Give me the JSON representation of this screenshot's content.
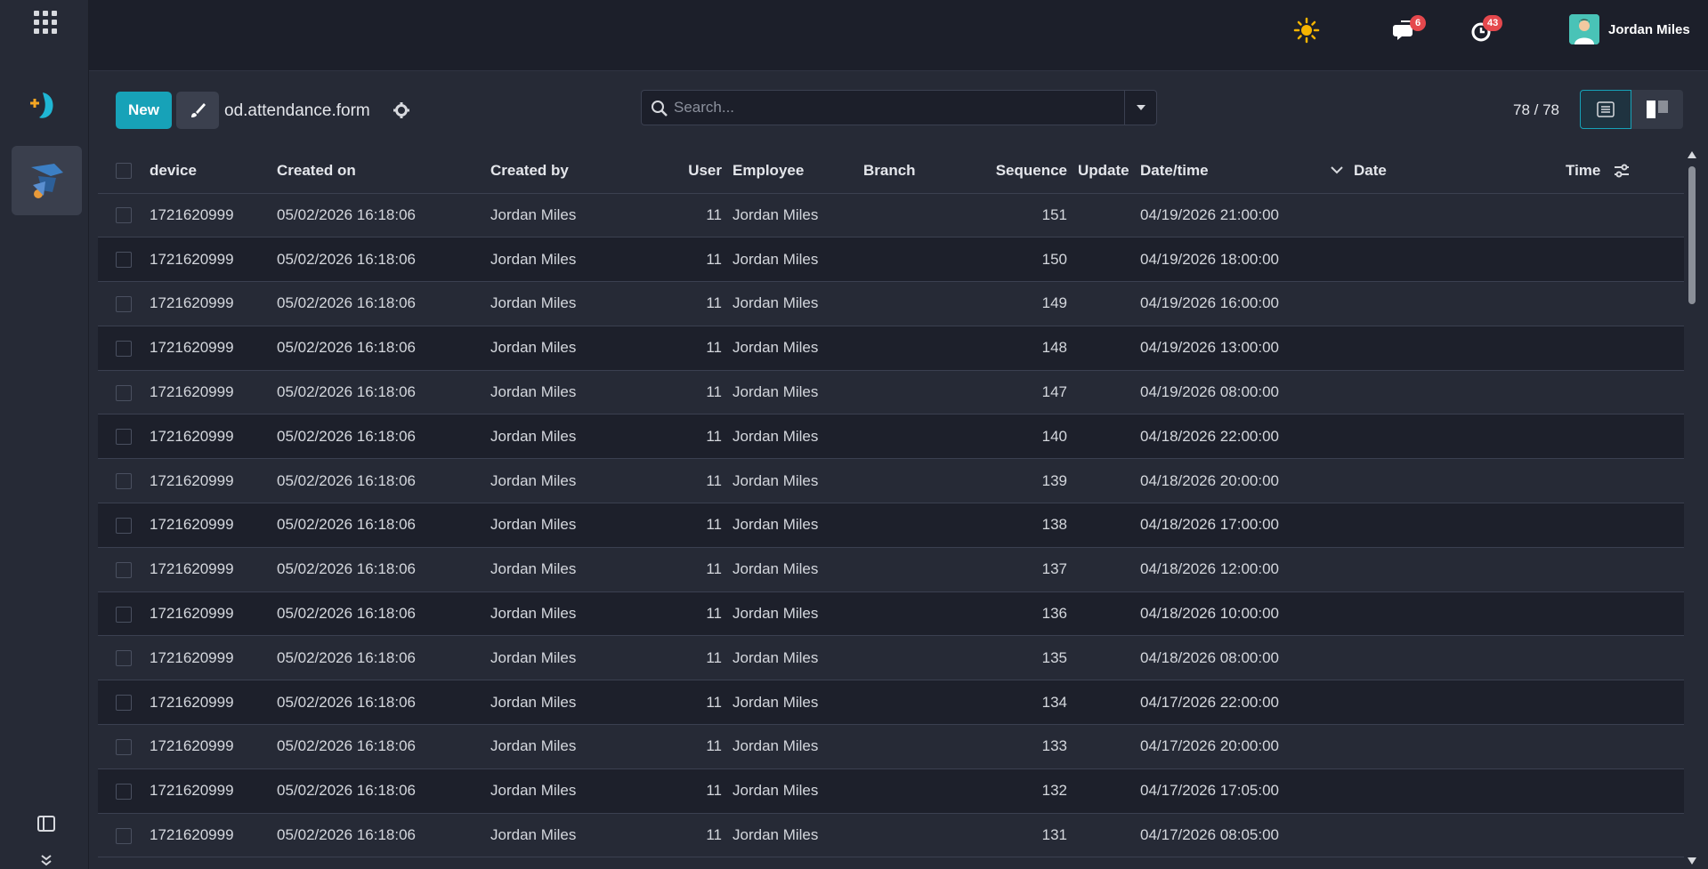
{
  "topbar": {
    "user_name": "Jordan Miles",
    "messages_count": "6",
    "activities_count": "43"
  },
  "control": {
    "new_label": "New",
    "model_name": "od.attendance.form",
    "search_placeholder": "Search...",
    "pager": "78 / 78"
  },
  "table": {
    "headers": {
      "device": "device",
      "created_on": "Created on",
      "created_by": "Created by",
      "user": "User",
      "employee": "Employee",
      "branch": "Branch",
      "sequence": "Sequence",
      "update": "Update",
      "datetime": "Date/time",
      "date": "Date",
      "time": "Time"
    },
    "rows": [
      {
        "device": "1721620999",
        "created_on": "05/02/2026 16:18:06",
        "created_by": "Jordan Miles",
        "user": "11",
        "employee": "Jordan Miles",
        "branch": "",
        "sequence": "151",
        "update": "",
        "datetime": "04/19/2026 21:00:00",
        "date": "",
        "time": ""
      },
      {
        "device": "1721620999",
        "created_on": "05/02/2026 16:18:06",
        "created_by": "Jordan Miles",
        "user": "11",
        "employee": "Jordan Miles",
        "branch": "",
        "sequence": "150",
        "update": "",
        "datetime": "04/19/2026 18:00:00",
        "date": "",
        "time": ""
      },
      {
        "device": "1721620999",
        "created_on": "05/02/2026 16:18:06",
        "created_by": "Jordan Miles",
        "user": "11",
        "employee": "Jordan Miles",
        "branch": "",
        "sequence": "149",
        "update": "",
        "datetime": "04/19/2026 16:00:00",
        "date": "",
        "time": ""
      },
      {
        "device": "1721620999",
        "created_on": "05/02/2026 16:18:06",
        "created_by": "Jordan Miles",
        "user": "11",
        "employee": "Jordan Miles",
        "branch": "",
        "sequence": "148",
        "update": "",
        "datetime": "04/19/2026 13:00:00",
        "date": "",
        "time": ""
      },
      {
        "device": "1721620999",
        "created_on": "05/02/2026 16:18:06",
        "created_by": "Jordan Miles",
        "user": "11",
        "employee": "Jordan Miles",
        "branch": "",
        "sequence": "147",
        "update": "",
        "datetime": "04/19/2026 08:00:00",
        "date": "",
        "time": ""
      },
      {
        "device": "1721620999",
        "created_on": "05/02/2026 16:18:06",
        "created_by": "Jordan Miles",
        "user": "11",
        "employee": "Jordan Miles",
        "branch": "",
        "sequence": "140",
        "update": "",
        "datetime": "04/18/2026 22:00:00",
        "date": "",
        "time": ""
      },
      {
        "device": "1721620999",
        "created_on": "05/02/2026 16:18:06",
        "created_by": "Jordan Miles",
        "user": "11",
        "employee": "Jordan Miles",
        "branch": "",
        "sequence": "139",
        "update": "",
        "datetime": "04/18/2026 20:00:00",
        "date": "",
        "time": ""
      },
      {
        "device": "1721620999",
        "created_on": "05/02/2026 16:18:06",
        "created_by": "Jordan Miles",
        "user": "11",
        "employee": "Jordan Miles",
        "branch": "",
        "sequence": "138",
        "update": "",
        "datetime": "04/18/2026 17:00:00",
        "date": "",
        "time": ""
      },
      {
        "device": "1721620999",
        "created_on": "05/02/2026 16:18:06",
        "created_by": "Jordan Miles",
        "user": "11",
        "employee": "Jordan Miles",
        "branch": "",
        "sequence": "137",
        "update": "",
        "datetime": "04/18/2026 12:00:00",
        "date": "",
        "time": ""
      },
      {
        "device": "1721620999",
        "created_on": "05/02/2026 16:18:06",
        "created_by": "Jordan Miles",
        "user": "11",
        "employee": "Jordan Miles",
        "branch": "",
        "sequence": "136",
        "update": "",
        "datetime": "04/18/2026 10:00:00",
        "date": "",
        "time": ""
      },
      {
        "device": "1721620999",
        "created_on": "05/02/2026 16:18:06",
        "created_by": "Jordan Miles",
        "user": "11",
        "employee": "Jordan Miles",
        "branch": "",
        "sequence": "135",
        "update": "",
        "datetime": "04/18/2026 08:00:00",
        "date": "",
        "time": ""
      },
      {
        "device": "1721620999",
        "created_on": "05/02/2026 16:18:06",
        "created_by": "Jordan Miles",
        "user": "11",
        "employee": "Jordan Miles",
        "branch": "",
        "sequence": "134",
        "update": "",
        "datetime": "04/17/2026 22:00:00",
        "date": "",
        "time": ""
      },
      {
        "device": "1721620999",
        "created_on": "05/02/2026 16:18:06",
        "created_by": "Jordan Miles",
        "user": "11",
        "employee": "Jordan Miles",
        "branch": "",
        "sequence": "133",
        "update": "",
        "datetime": "04/17/2026 20:00:00",
        "date": "",
        "time": ""
      },
      {
        "device": "1721620999",
        "created_on": "05/02/2026 16:18:06",
        "created_by": "Jordan Miles",
        "user": "11",
        "employee": "Jordan Miles",
        "branch": "",
        "sequence": "132",
        "update": "",
        "datetime": "04/17/2026 17:05:00",
        "date": "",
        "time": ""
      },
      {
        "device": "1721620999",
        "created_on": "05/02/2026 16:18:06",
        "created_by": "Jordan Miles",
        "user": "11",
        "employee": "Jordan Miles",
        "branch": "",
        "sequence": "131",
        "update": "",
        "datetime": "04/17/2026 08:05:00",
        "date": "",
        "time": ""
      }
    ]
  },
  "colors": {
    "accent": "#17a2b8",
    "badge": "#e5484d",
    "background": "#262a36",
    "topbar": "#1c1f2a"
  },
  "icons": [
    "apps-grid-icon",
    "app-logo-icon",
    "attendance-app-icon",
    "sun-icon",
    "chat-icon",
    "clock-icon",
    "brush-icon",
    "gear-icon",
    "search-icon",
    "caret-down-icon",
    "list-view-icon",
    "split-view-icon",
    "column-settings-icon",
    "sort-desc-icon",
    "sidebar-toggle-icon",
    "chevrons-down-icon"
  ]
}
